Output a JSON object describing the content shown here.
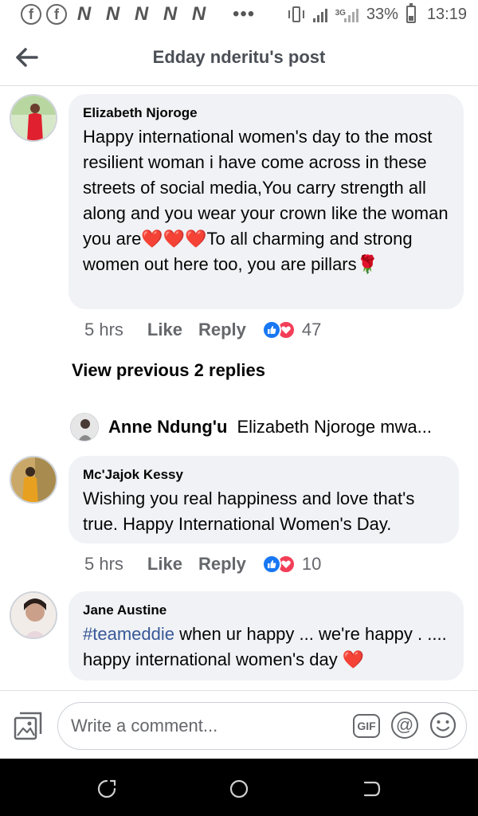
{
  "status_bar": {
    "notification_icons": [
      "facebook-icon",
      "facebook-icon",
      "n-icon",
      "n-icon",
      "n-icon",
      "n-icon",
      "n-icon"
    ],
    "more": "•••",
    "network_type": "3G",
    "battery_percent": "33%",
    "time": "13:19"
  },
  "header": {
    "title": "Edday nderitu's post"
  },
  "comments": [
    {
      "author": "Elizabeth Njoroge",
      "text": "Happy international women's day to the most resilient woman i have come across in these streets of social media,You carry strength all along and you wear your crown like the woman you are❤️❤️❤️To all charming and strong women out here too, you are pillars🌹",
      "time": "5 hrs",
      "like_label": "Like",
      "reply_label": "Reply",
      "reaction_count": "47",
      "reactions": [
        "like",
        "love"
      ]
    },
    {
      "author": "Mc'Jajok Kessy",
      "text": "Wishing you real happiness and love that's true. Happy International Women's Day.",
      "time": "5 hrs",
      "like_label": "Like",
      "reply_label": "Reply",
      "reaction_count": "10",
      "reactions": [
        "like",
        "love"
      ]
    },
    {
      "author": "Jane Austine",
      "hashtag": "#teameddie",
      "text": " when ur happy ... we're happy . .... happy international women's day ❤️"
    }
  ],
  "view_previous_replies": "View previous 2 replies",
  "reply_preview": {
    "author": "Anne Ndung'u",
    "text": "Elizabeth Njoroge mwa..."
  },
  "composer": {
    "placeholder": "Write a comment...",
    "gif_label": "GIF",
    "at_label": "@"
  },
  "colors": {
    "like_blue": "#1877f2",
    "love_red": "#f33e58",
    "bubble_bg": "#f0f2f5",
    "hashtag": "#385898"
  }
}
